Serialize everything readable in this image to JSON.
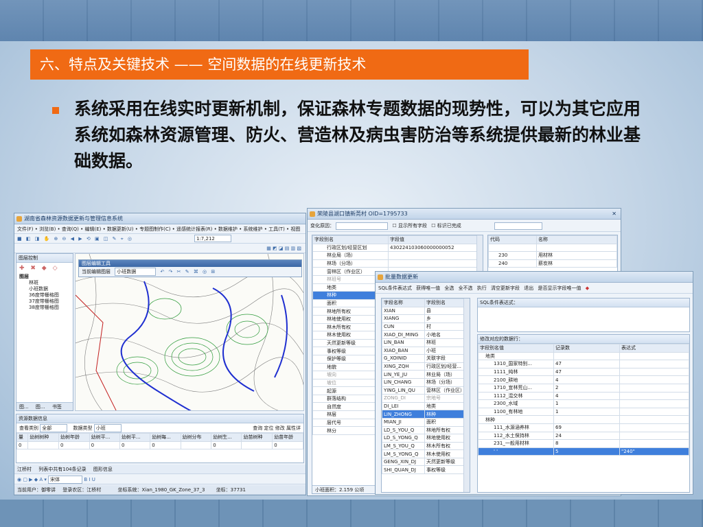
{
  "slide": {
    "title": "六、特点及关键技术 —— 空间数据的在线更新技术",
    "bullet": "系统采用在线实时更新机制，保证森林专题数据的现势性，可以为其它应用系统如森林资源管理、防火、营造林及病虫害防治等系统提供最新的林业基础数据。"
  },
  "colors": {
    "title_bg": "#f06a14",
    "selection": "#3f7fdc"
  },
  "main_window": {
    "title": "湖南省森林资源数据更新与管理信息系统",
    "menu": "文件(F) • 浏览(B) • 查询(Q) • 编辑(E) • 数据更新(U) • 专题图制作(C) • 遥感统计报表(R) • 数据维护 • 系统维护 • 工具(T) • 视图",
    "scale": "1:7,212",
    "layer_panel_title": "图层控制",
    "layers": [
      "图层",
      "林斑",
      "小班数据",
      "36度带栅格图",
      "37度带栅格图",
      "38度带栅格图"
    ],
    "left_tabs": [
      "图...",
      "图...",
      "书签"
    ],
    "float_toolbar_title": "图层编辑工具",
    "float_toolbar_layer": "当前编辑图层",
    "float_toolbar_value": "小班数据",
    "resource_panel_title": "资源数据信息",
    "query_label": "查看类别",
    "query_value": "全部",
    "data_type_label": "数据类型",
    "data_type_value": "小班",
    "query_buttons": [
      "查询",
      "定位",
      "修改",
      "属性详"
    ],
    "grid_headers": [
      "量",
      "幼树树种",
      "幼树年龄",
      "幼树平...",
      "幼树平...",
      "幼树每...",
      "幼树分布",
      "幼树生...",
      "幼苗树种",
      "幼苗年龄"
    ],
    "grid_row": [
      "0",
      "",
      "0",
      "0",
      "0",
      "0",
      "",
      "0",
      "",
      "0"
    ],
    "status_tabs": [
      "江桥村",
      "列表中共有104条记录",
      "图形信息"
    ],
    "bottom_font": "宋体",
    "status_user": "当前用户：御零讲",
    "status_login": "登录农区：江桥村",
    "status_coord": "坐标系统：Xian_1980_GK_Zone_37_3",
    "status_x": "坐标：37731"
  },
  "edit_window": {
    "title": "荣陵县湖口镇新莞村 OID=1795733",
    "change_reason_label": "变化原因：",
    "show_all": "显示所有字段",
    "mark_done": "标识已完成",
    "headers": [
      "字段别名",
      "字段值"
    ],
    "rows": [
      [
        "行政区划/经营区划",
        "430224103060000000052"
      ],
      [
        "林业局（场）",
        ""
      ],
      [
        "林场（分场）",
        ""
      ],
      [
        "营林区（作业区）",
        ""
      ],
      [
        "林班号",
        ""
      ],
      [
        "地类",
        ""
      ],
      [
        "林种",
        ""
      ],
      [
        "面积",
        ""
      ],
      [
        "林地所有权",
        ""
      ],
      [
        "林地使用权",
        ""
      ],
      [
        "林木所有权",
        ""
      ],
      [
        "林木使用权",
        ""
      ],
      [
        "天然更新等级",
        ""
      ],
      [
        "事权等级",
        ""
      ],
      [
        "保护等级",
        ""
      ],
      [
        "地貌",
        ""
      ],
      [
        "坡向",
        ""
      ],
      [
        "坡位",
        ""
      ],
      [
        "起源",
        ""
      ],
      [
        "群落结构",
        ""
      ],
      [
        "自然度",
        ""
      ],
      [
        "林层",
        ""
      ],
      [
        "层代号",
        ""
      ],
      [
        "林分",
        ""
      ]
    ],
    "footer": "小班面积：2.159 公顷",
    "code_headers": [
      "代码",
      "名称"
    ],
    "code_rows": [
      [
        "230",
        "用材林"
      ],
      [
        "240",
        "薪炭林"
      ]
    ]
  },
  "batch_window": {
    "title": "批量数据更新",
    "toolbar": [
      "SQL条件表达式",
      "获得唯一值",
      "全选",
      "全不选",
      "执行",
      "清空更新字段",
      "退出",
      "是否显示字段唯一值"
    ],
    "field_headers": [
      "字段名称",
      "字段别名"
    ],
    "fields": [
      [
        "XIAN",
        "县"
      ],
      [
        "XIANG",
        "乡"
      ],
      [
        "CUN",
        "村"
      ],
      [
        "XIAO_DI_MING",
        "小地名"
      ],
      [
        "LIN_BAN",
        "林班"
      ],
      [
        "XIAO_BAN",
        "小班"
      ],
      [
        "G_XOINID",
        "关联字段"
      ],
      [
        "XING_ZQH",
        "行政区划/经营..."
      ],
      [
        "LIN_YE_JU",
        "林业局（场）"
      ],
      [
        "LIN_CHANG",
        "林场（分场）"
      ],
      [
        "YING_LIN_QU",
        "营林区（作业区）"
      ],
      [
        "ZONG_DI",
        "宗地号"
      ],
      [
        "DI_LEI",
        "地类"
      ],
      [
        "LIN_ZHONG",
        "林种"
      ],
      [
        "MIAN_JI",
        "面积"
      ],
      [
        "LD_S_YOU_Q",
        "林地所有权"
      ],
      [
        "LD_S_YONG_Q",
        "林地使用权"
      ],
      [
        "LM_S_YOU_Q",
        "林木所有权"
      ],
      [
        "LM_S_YONG_Q",
        "林木使用权"
      ],
      [
        "GENG_XIN_DJ",
        "天然更新等级"
      ],
      [
        "SHI_QUAN_DJ",
        "事权等级"
      ]
    ],
    "sql_title": "SQL条件表达式：",
    "modify_title": "修改对应的数据行：",
    "mod_headers": [
      "字段别名值",
      "记录数",
      "表达式"
    ],
    "mod_rows": [
      {
        "label": "地类",
        "count": "",
        "expr": "",
        "level": 0
      },
      {
        "label": "1310_国家特别...",
        "count": "47",
        "expr": "",
        "level": 1
      },
      {
        "label": "1111_纯林",
        "count": "47",
        "expr": "",
        "level": 1
      },
      {
        "label": "2100_耕地",
        "count": "4",
        "expr": "",
        "level": 1
      },
      {
        "label": "1710_宜林荒山...",
        "count": "2",
        "expr": "",
        "level": 1
      },
      {
        "label": "1112_混交林",
        "count": "4",
        "expr": "",
        "level": 1
      },
      {
        "label": "2300_水域",
        "count": "1",
        "expr": "",
        "level": 1
      },
      {
        "label": "1100_有林地",
        "count": "1",
        "expr": "",
        "level": 1
      },
      {
        "label": "林种",
        "count": "",
        "expr": "",
        "level": 0
      },
      {
        "label": "111_水源涵养林",
        "count": "69",
        "expr": "",
        "level": 1
      },
      {
        "label": "112_水土保持林",
        "count": "24",
        "expr": "",
        "level": 1
      },
      {
        "label": "231_一般用材林",
        "count": "8",
        "expr": "",
        "level": 1
      },
      {
        "label": "' '",
        "count": "5",
        "expr": "\"240\"",
        "level": 1
      }
    ]
  }
}
